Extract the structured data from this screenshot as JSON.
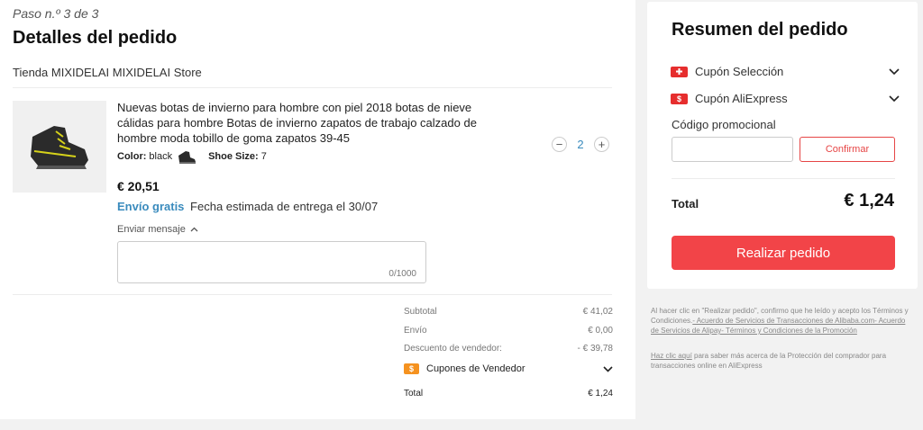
{
  "step": "Paso n.º 3 de 3",
  "title": "Detalles del pedido",
  "store": "Tienda MIXIDELAI MIXIDELAI Store",
  "product": {
    "image_icon": "boot-image",
    "title": "Nuevas botas de invierno para hombre con piel 2018 botas de nieve cálidas para hombre Botas de invierno zapatos de trabajo calzado de hombre moda tobillo de goma zapatos 39-45",
    "color_label": "Color:",
    "color_value": "black",
    "size_label": "Shoe Size:",
    "size_value": "7",
    "quantity": "2",
    "minus": "−",
    "plus": "+",
    "price": "€ 20,51",
    "free_shipping": "Envío gratis",
    "delivery": "Fecha estimada de entrega el 30/07",
    "message_label": "Enviar mensaje",
    "message_counter": "0/1000"
  },
  "summary": {
    "subtotal_label": "Subtotal",
    "subtotal_value": "€ 41,02",
    "shipping_label": "Envío",
    "shipping_value": "€ 0,00",
    "discount_label": "Descuento de vendedor:",
    "discount_value": "- € 39,78",
    "coupon_tag": "$",
    "coupon_label": "Cupones de Vendedor",
    "total_label": "Total",
    "total_value": "€ 1,24"
  },
  "card": {
    "title": "Resumen del pedido",
    "coupon_selection": "Cupón Selección",
    "coupon_aliexpress": "Cupón AliExpress",
    "flag_tag": "$",
    "promo_label": "Código promocional",
    "confirm": "Confirmar",
    "total_label": "Total",
    "total_value": "€ 1,24",
    "order_button": "Realizar pedido"
  },
  "legal": {
    "text1": "Al hacer clic en \"Realizar pedido\", confirmo que he leído y acepto los Términos y Condiciones.",
    "link1": "- Acuerdo de Servicios de Transacciones de Alibaba.com- Acuerdo de Servicios de Alipay- Términos y Condiciones de la Promoción",
    "link2": "Haz clic aquí",
    "text2": " para saber más acerca de la Protección del comprador para transacciones online en AliExpress"
  },
  "colors": {
    "accent": "#f24448",
    "link": "#3a8bbd",
    "coupon_orange": "#f5921f"
  }
}
